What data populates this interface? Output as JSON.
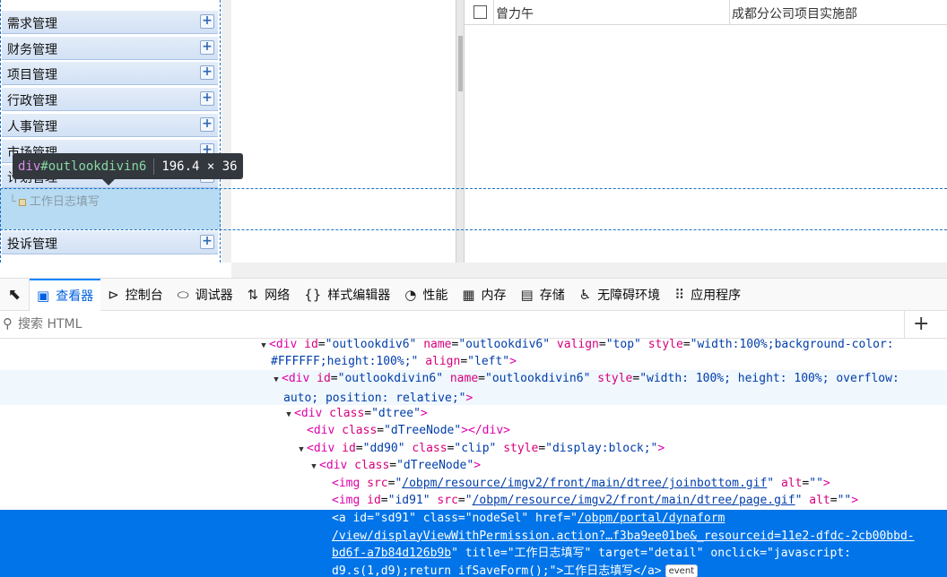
{
  "sidebar": {
    "items": [
      {
        "label": "需求管理"
      },
      {
        "label": "财务管理"
      },
      {
        "label": "项目管理"
      },
      {
        "label": "行政管理"
      },
      {
        "label": "人事管理"
      },
      {
        "label": "市场管理"
      },
      {
        "label": "计划管理"
      },
      {
        "label": "投诉管理"
      }
    ],
    "expand_glyph": "+",
    "tree_node_label": "工作日志填写"
  },
  "inspector_tooltip": {
    "tag": "div",
    "id": "#outlookdivin6",
    "size": "196.4 × 36"
  },
  "grid": {
    "rows": [
      {
        "name": "曾力午",
        "dept": "成都分公司项目实施部"
      }
    ]
  },
  "devtools": {
    "tabs": [
      {
        "label": "查看器",
        "icon": "inspector-icon",
        "active": true
      },
      {
        "label": "控制台",
        "icon": "console-icon",
        "active": false
      },
      {
        "label": "调试器",
        "icon": "debugger-icon",
        "active": false
      },
      {
        "label": "网络",
        "icon": "network-icon",
        "active": false
      },
      {
        "label": "样式编辑器",
        "icon": "style-editor-icon",
        "active": false
      },
      {
        "label": "性能",
        "icon": "performance-icon",
        "active": false
      },
      {
        "label": "内存",
        "icon": "memory-icon",
        "active": false
      },
      {
        "label": "存储",
        "icon": "storage-icon",
        "active": false
      },
      {
        "label": "无障碍环境",
        "icon": "accessibility-icon",
        "active": false
      },
      {
        "label": "应用程序",
        "icon": "application-icon",
        "active": false
      }
    ],
    "search_placeholder": "搜索 HTML",
    "add_node_glyph": "+",
    "event_badge": "event"
  },
  "markup": {
    "l0_tag": "div",
    "l0_id_val": "\"outlookdiv6\"",
    "l0_name_val": "\"outlookdiv6\"",
    "l0_valign_val": "\"top\"",
    "l0_style_val_a": "\"width:100%;background-color:",
    "l0_style_val_b": "#FFFFFF;height:100%;\"",
    "l0_align_val": "\"left\"",
    "l1_id_val": "\"outlookdivin6\"",
    "l1_name_val": "\"outlookdivin6\"",
    "l1_style_val_a": "\"width: 100%; height: 100%; overflow:",
    "l1_style_val_b": "auto; position: relative;\"",
    "l2_class_val": "\"dtree\"",
    "l3_class_val": "\"dTreeNode\"",
    "l4_id_val": "\"dd90\"",
    "l4_class_val": "\"clip\"",
    "l4_style_val": "\"display:block;\"",
    "l5_class_val": "\"dTreeNode\"",
    "l6_src_val": "/obpm/resource/imgv2/front/main/dtree/joinbottom.gif",
    "l7_id_val": "\"id91\"",
    "l7_src_val": "/obpm/resource/imgv2/front/main/dtree/page.gif",
    "l8_id_val": "\"sd91\"",
    "l8_class_val": "\"nodeSel\"",
    "l8_href_a": "/obpm/portal/dynaform",
    "l8_href_b": "/view/displayViewWithPermission.action?…f3ba9ee01be&_resourceid=11e2-dfdc-2cb00bbd-",
    "l8_href_c": "bd6f-a7b84d126b9b",
    "l8_title_val": "\"工作日志填写\"",
    "l8_target_val": "\"detail\"",
    "l8_onclick_a": "\"javascript:",
    "l8_onclick_b": "d9.s(1,d9);return ifSaveForm();\"",
    "l8_text": "工作日志填写"
  }
}
